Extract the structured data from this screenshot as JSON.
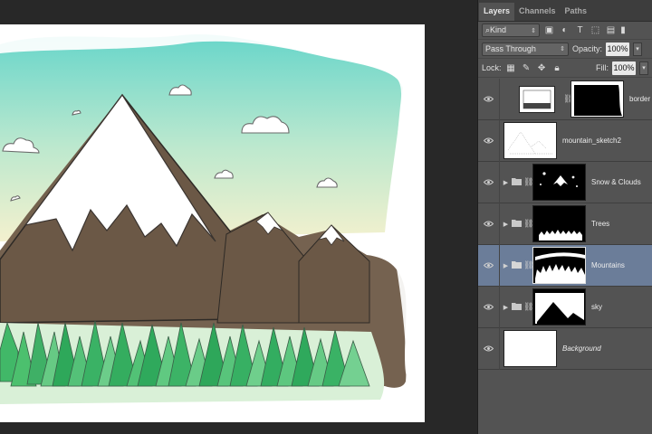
{
  "panel": {
    "tabs": [
      {
        "label": "Layers",
        "active": true
      },
      {
        "label": "Channels",
        "active": false
      },
      {
        "label": "Paths",
        "active": false
      }
    ],
    "filter": {
      "label": "Kind",
      "icons": [
        "image-filter-icon",
        "adjustment-filter-icon",
        "type-filter-icon",
        "shape-filter-icon",
        "smart-object-filter-icon",
        "filter-toggle-icon"
      ]
    },
    "blend_mode": "Pass Through",
    "opacity_label": "Opacity:",
    "opacity_value": "100%",
    "lock_label": "Lock:",
    "fill_label": "Fill:",
    "fill_value": "100%"
  },
  "layers": [
    {
      "name": "border",
      "type": "masked",
      "visible": true,
      "selected": false
    },
    {
      "name": "mountain_sketch2",
      "type": "pixel",
      "visible": true,
      "selected": false
    },
    {
      "name": "Snow & Clouds",
      "type": "group",
      "visible": true,
      "selected": false
    },
    {
      "name": "Trees",
      "type": "group",
      "visible": true,
      "selected": false
    },
    {
      "name": "Mountains",
      "type": "group",
      "visible": true,
      "selected": true
    },
    {
      "name": "sky",
      "type": "group",
      "visible": true,
      "selected": false
    },
    {
      "name": "Background",
      "type": "background",
      "visible": true,
      "selected": false
    }
  ],
  "colors": {
    "panel_bg": "#535353",
    "selected_layer": "#6b7d99",
    "workspace_bg": "#282828",
    "sky": "#5fd3c6",
    "mountain": "#6e5a47",
    "snow": "#ffffff",
    "trees": "#3fb56a"
  }
}
